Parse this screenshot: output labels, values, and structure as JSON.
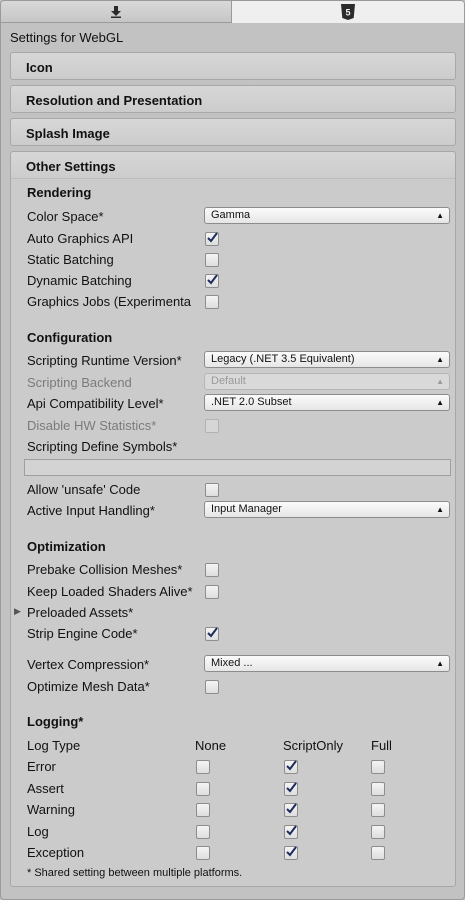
{
  "tabs": [
    {
      "icon": "download-arrow-icon"
    },
    {
      "icon": "html5-icon",
      "label": "5"
    }
  ],
  "title": "Settings for WebGL",
  "sections": {
    "icon": "Icon",
    "resolution": "Resolution and Presentation",
    "splash": "Splash Image",
    "other": "Other Settings"
  },
  "rendering": {
    "heading": "Rendering",
    "color_space_label": "Color Space*",
    "color_space_value": "Gamma",
    "auto_graphics_label": "Auto Graphics API",
    "auto_graphics_checked": true,
    "static_batching_label": "Static Batching",
    "static_batching_checked": false,
    "dynamic_batching_label": "Dynamic Batching",
    "dynamic_batching_checked": true,
    "graphics_jobs_label": "Graphics Jobs (Experimenta",
    "graphics_jobs_checked": false
  },
  "configuration": {
    "heading": "Configuration",
    "runtime_label": "Scripting Runtime Version*",
    "runtime_value": "Legacy (.NET 3.5 Equivalent)",
    "backend_label": "Scripting Backend",
    "backend_value": "Default",
    "api_label": "Api Compatibility Level*",
    "api_value": ".NET 2.0 Subset",
    "hw_stats_label": "Disable HW Statistics*",
    "define_symbols_label": "Scripting Define Symbols*",
    "define_symbols_value": "",
    "unsafe_label": "Allow 'unsafe' Code",
    "input_label": "Active Input Handling*",
    "input_value": "Input Manager"
  },
  "optimization": {
    "heading": "Optimization",
    "prebake_label": "Prebake Collision Meshes*",
    "keep_shaders_label": "Keep Loaded Shaders Alive*",
    "preloaded_label": "Preloaded Assets*",
    "strip_label": "Strip Engine Code*",
    "strip_checked": true,
    "vertex_label": "Vertex Compression*",
    "vertex_value": "Mixed ...",
    "optimize_mesh_label": "Optimize Mesh Data*"
  },
  "logging": {
    "heading": "Logging*",
    "col_type": "Log Type",
    "col_none": "None",
    "col_script": "ScriptOnly",
    "col_full": "Full",
    "rows": [
      {
        "label": "Error",
        "selected": "ScriptOnly"
      },
      {
        "label": "Assert",
        "selected": "ScriptOnly"
      },
      {
        "label": "Warning",
        "selected": "ScriptOnly"
      },
      {
        "label": "Log",
        "selected": "ScriptOnly"
      },
      {
        "label": "Exception",
        "selected": "ScriptOnly"
      }
    ]
  },
  "footnote": "* Shared setting between multiple platforms."
}
